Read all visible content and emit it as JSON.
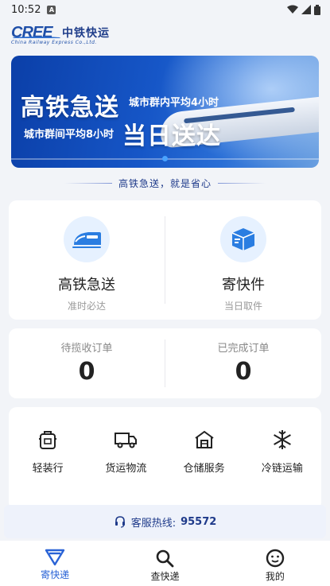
{
  "status_bar": {
    "time": "10:52",
    "notif_letter": "A"
  },
  "logo": {
    "mark": "CREE",
    "name_cn": "中铁快运",
    "name_en": "China Railway Express Co.,Ltd."
  },
  "banner": {
    "title_left": "高铁急送",
    "sub_top": "城市群内平均4小时",
    "sub_bottom": "城市群间平均8小时",
    "title_right": "当日送达"
  },
  "slogan": "高铁急送，就是省心",
  "services": [
    {
      "title": "高铁急送",
      "subtitle": "准时必达",
      "icon": "train-icon"
    },
    {
      "title": "寄快件",
      "subtitle": "当日取件",
      "icon": "package-icon"
    }
  ],
  "orders": [
    {
      "label": "待揽收订单",
      "value": "0"
    },
    {
      "label": "已完成订单",
      "value": "0"
    }
  ],
  "tools": [
    {
      "label": "轻装行",
      "icon": "backpack-icon"
    },
    {
      "label": "货运物流",
      "icon": "truck-icon"
    },
    {
      "label": "仓储服务",
      "icon": "warehouse-icon"
    },
    {
      "label": "冷链运输",
      "icon": "snowflake-icon"
    }
  ],
  "hotline": {
    "label": "客服热线:",
    "number": "95572"
  },
  "tabs": [
    {
      "label": "寄快递",
      "icon": "send-icon",
      "active": true
    },
    {
      "label": "查快递",
      "icon": "search-icon",
      "active": false
    },
    {
      "label": "我的",
      "icon": "profile-icon",
      "active": false
    }
  ],
  "colors": {
    "primary": "#2a63d6",
    "banner": "#1656c7",
    "background": "#f2f4f8"
  }
}
